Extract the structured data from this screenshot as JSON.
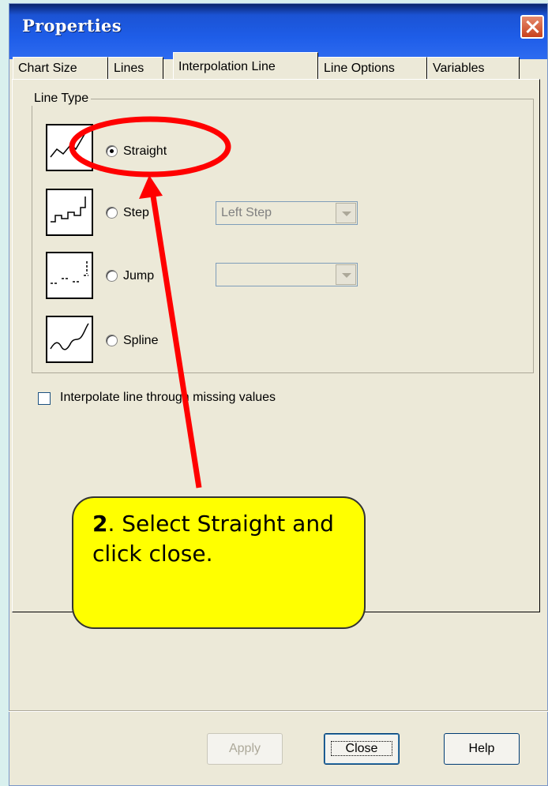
{
  "window": {
    "title": "Properties"
  },
  "tabs": [
    {
      "label": "Chart Size"
    },
    {
      "label": "Lines"
    },
    {
      "label": "Interpolation Line"
    },
    {
      "label": "Line Options"
    },
    {
      "label": "Variables"
    }
  ],
  "active_tab": "Interpolation Line",
  "line_type": {
    "group_label": "Line Type",
    "options": [
      {
        "label": "Straight",
        "checked": true
      },
      {
        "label": "Step",
        "checked": false
      },
      {
        "label": "Jump",
        "checked": false
      },
      {
        "label": "Spline",
        "checked": false
      }
    ],
    "step_combo_value": "Left Step",
    "jump_combo_value": ""
  },
  "interpolate_missing": {
    "label": "Interpolate line through missing values",
    "checked": false
  },
  "buttons": {
    "apply": "Apply",
    "close": "Close",
    "help": "Help"
  },
  "annotation": {
    "step_number": "2",
    "text": ". Select Straight and click close.",
    "highlight_color": "#ff0000",
    "callout_color": "#ffff00"
  }
}
